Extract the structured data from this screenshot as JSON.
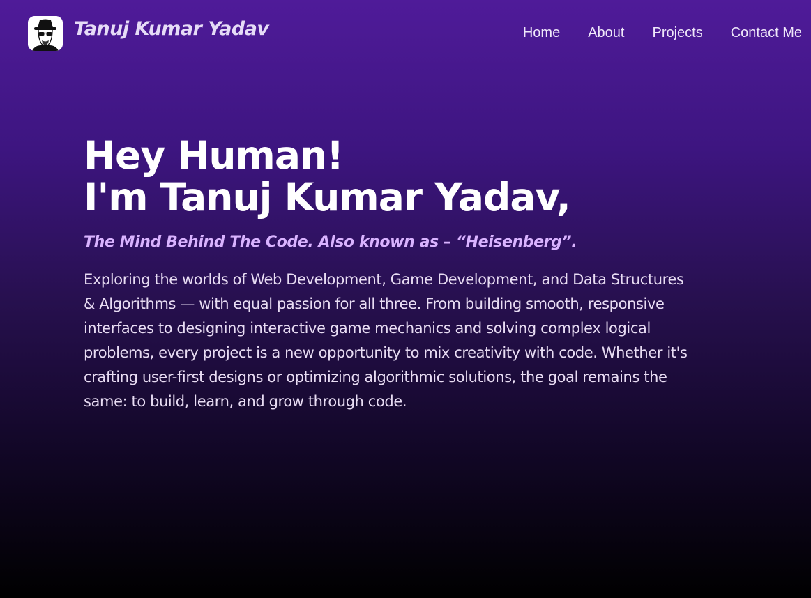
{
  "header": {
    "logo_icon": "heisenberg-avatar-icon",
    "brand_name": "Tanuj Kumar Yadav",
    "nav": [
      {
        "label": "Home"
      },
      {
        "label": "About"
      },
      {
        "label": "Projects"
      },
      {
        "label": "Contact Me"
      }
    ]
  },
  "hero": {
    "greeting": "Hey Human!",
    "intro": "I'm Tanuj Kumar Yadav,",
    "tagline": "The Mind Behind The Code. Also known as – “Heisenberg”.",
    "description": "Exploring the worlds of Web Development, Game Development, and Data Structures & Algorithms — with equal passion for all three. From building smooth, responsive interfaces to designing interactive game mechanics and solving complex logical problems, every project is a new opportunity to mix creativity with code. Whether it's crafting user-first designs or optimizing algorithmic solutions, the goal remains the same: to build, learn, and grow through code."
  },
  "colors": {
    "background_top": "#4f1b99",
    "background_bottom": "#000000",
    "tagline": "#d9b3ff",
    "text": "#ffffff"
  }
}
